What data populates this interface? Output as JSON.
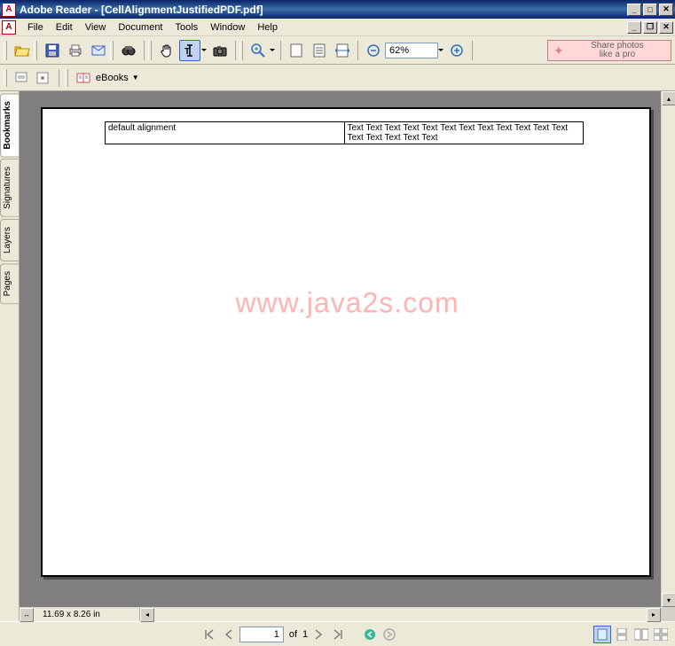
{
  "titlebar": {
    "app_icon_letter": "A",
    "title": "Adobe Reader - [CellAlignmentJustifiedPDF.pdf]"
  },
  "menubar": {
    "app_icon_letter": "A",
    "items": [
      "File",
      "Edit",
      "View",
      "Document",
      "Tools",
      "Window",
      "Help"
    ]
  },
  "toolbar1": {
    "zoom_value": "62%",
    "share_line1": "Share photos",
    "share_line2": "like a pro"
  },
  "toolbar2": {
    "ebooks_label": "eBooks"
  },
  "sidebar": {
    "tabs": [
      {
        "label": "Bookmarks",
        "active": true
      },
      {
        "label": "Signatures",
        "active": false
      },
      {
        "label": "Layers",
        "active": false
      },
      {
        "label": "Pages",
        "active": false
      }
    ]
  },
  "document": {
    "table": {
      "cell_left": "default alignment",
      "cell_right": "Text Text Text Text Text Text Text Text Text Text Text Text Text Text Text Text Text"
    },
    "watermark": "www.java2s.com",
    "dimensions": "11.69 x 8.26 in"
  },
  "statusbar": {
    "page_current": "1",
    "page_of_label": "of",
    "page_total": "1"
  }
}
